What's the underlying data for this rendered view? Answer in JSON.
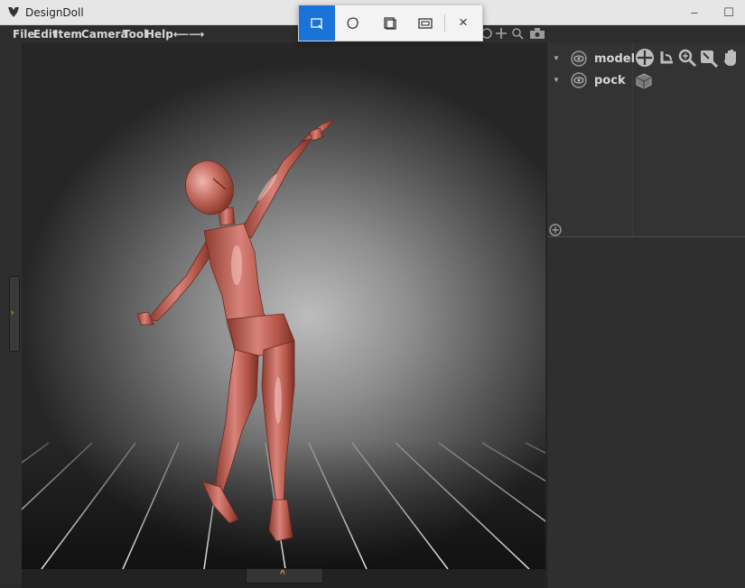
{
  "window": {
    "title": "DesignDoll",
    "minimize_symbol": "–",
    "maximize_symbol": "☐"
  },
  "snip_toolbar": {
    "tools": [
      "rectangular-snip-icon",
      "freeform-snip-icon",
      "window-snip-icon",
      "fullscreen-snip-icon"
    ],
    "active_tool": "rectangular-snip-icon",
    "close_symbol": "×",
    "accent_color": "#1a73d9"
  },
  "menu": {
    "items": [
      "File",
      "Edit",
      "Item",
      "Camera",
      "Tool",
      "Help⟵⟶"
    ]
  },
  "camera_tools": [
    "rotate-icon",
    "move-icon",
    "zoom-icon",
    "camera-icon"
  ],
  "panel": {
    "tree": [
      {
        "label": "model",
        "icon": "eye-icon"
      },
      {
        "label": "pock",
        "icon": "eye-icon"
      }
    ],
    "tools": [
      "move-tool-icon",
      "rotate-tool-icon",
      "zoom-tool-icon",
      "reset-tool-icon",
      "hand-tool-icon"
    ],
    "extra_icon": "cube-icon",
    "add_icon": "add-icon"
  },
  "handles": {
    "side_arrow": "›",
    "bottom_arrow": "^",
    "accent_color": "#e0a62a"
  }
}
